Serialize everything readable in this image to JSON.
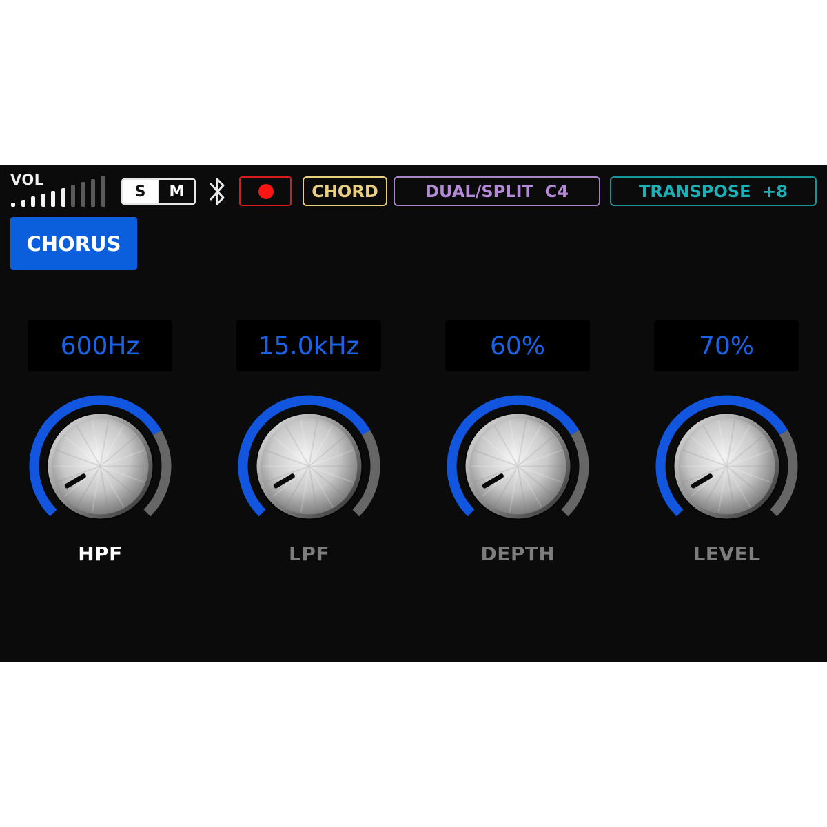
{
  "topbar": {
    "volume": {
      "label": "VOL",
      "level_bars_active": 6,
      "bars_total": 10
    },
    "sm_toggle": {
      "s_label": "S",
      "m_label": "M",
      "selected": "S"
    },
    "bluetooth": {
      "icon": "bluetooth-icon"
    },
    "record": {
      "icon": "record-dot-icon",
      "color": "#ff1414"
    },
    "chord": {
      "label": "CHORD",
      "color": "#e9cf7e"
    },
    "dual_split": {
      "label": "DUAL/SPLIT  C4",
      "color": "#b48ad8"
    },
    "transpose": {
      "label": "TRANSPOSE  +8",
      "color": "#1bb0b7"
    }
  },
  "effect_tab": {
    "label": "CHORUS",
    "color": "#0c5fdc"
  },
  "colors": {
    "arc_active": "#1256e0",
    "arc_inactive": "#666666",
    "value_text": "#1a63e6"
  },
  "knobs": [
    {
      "name": "hpf",
      "label": "HPF",
      "value": "600Hz",
      "fill": 0.72,
      "selected": true
    },
    {
      "name": "lpf",
      "label": "LPF",
      "value": "15.0kHz",
      "fill": 0.72,
      "selected": false
    },
    {
      "name": "depth",
      "label": "DEPTH",
      "value": "60%",
      "fill": 0.72,
      "selected": false
    },
    {
      "name": "level",
      "label": "LEVEL",
      "value": "70%",
      "fill": 0.72,
      "selected": false
    }
  ]
}
